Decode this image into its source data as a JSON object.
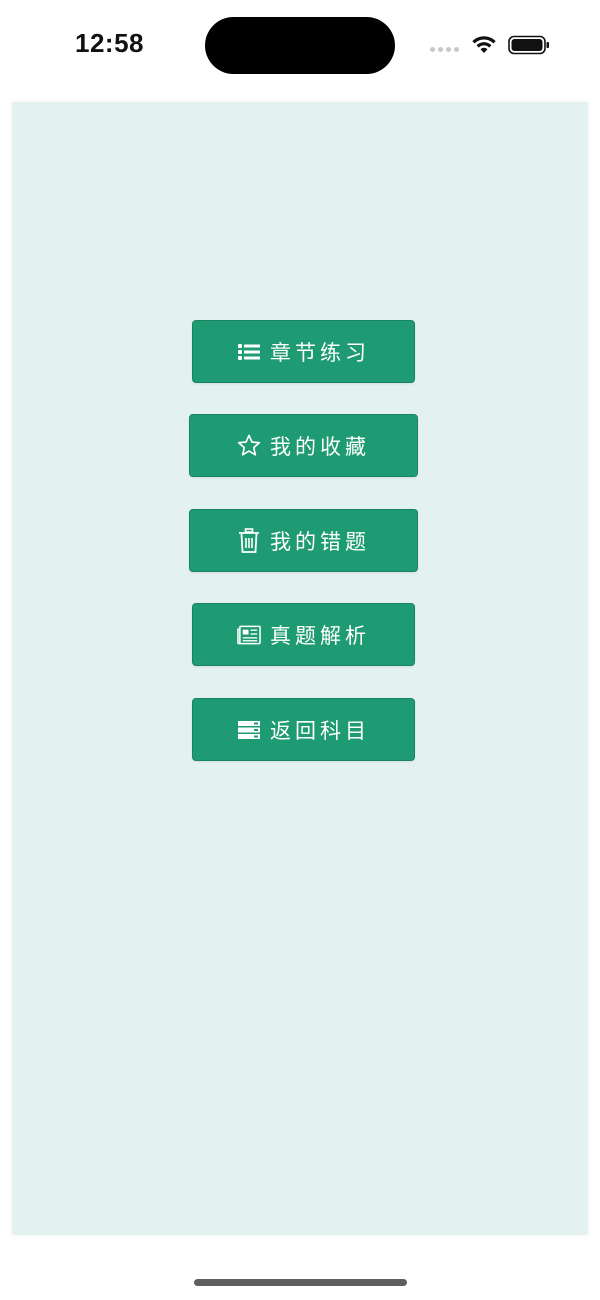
{
  "status_bar": {
    "time": "12:58"
  },
  "menu": {
    "items": [
      {
        "label": "章节练习",
        "icon": "list-icon"
      },
      {
        "label": "我的收藏",
        "icon": "star-icon"
      },
      {
        "label": "我的错题",
        "icon": "trash-icon"
      },
      {
        "label": "真题解析",
        "icon": "newspaper-icon"
      },
      {
        "label": "返回科目",
        "icon": "server-icon"
      }
    ]
  },
  "colors": {
    "button_bg": "#1e9b73",
    "panel_bg": "#e4f1f1",
    "text": "#ffffff"
  }
}
